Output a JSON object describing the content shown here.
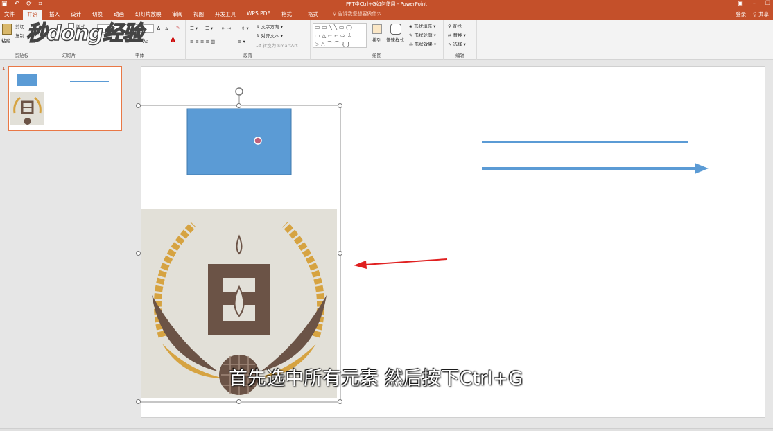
{
  "titlebar": {
    "title": "PPT中Ctrl+G如何使用 - PowerPoint",
    "quick_access": [
      "↶",
      "⟳",
      "⌗"
    ]
  },
  "tabs": [
    "文件",
    "开始",
    "插入",
    "设计",
    "切换",
    "动画",
    "幻灯片放映",
    "审阅",
    "视图",
    "开发工具",
    "WPS PDF",
    "格式",
    "格式"
  ],
  "active_tab": "开始",
  "tell_me": "♀ 告诉我您想要做什么...",
  "account": {
    "login": "登录",
    "share": "共享"
  },
  "ribbon": {
    "clipboard": {
      "paste": "粘贴",
      "cut": "剪切",
      "copy": "复制",
      "label": "剪贴板"
    },
    "slides": {
      "layout": "版式",
      "label": "幻灯片"
    },
    "font": {
      "grow": "A",
      "shrink": "A",
      "label": "字体",
      "spacing": "Aa"
    },
    "paragraph": {
      "text_direction": "文字方向",
      "align_text": "对齐文本",
      "smartart": "转换为 SmartArt",
      "label": "段落"
    },
    "drawing": {
      "arrange": "排列",
      "quick_styles": "快速样式",
      "fill": "形状填充",
      "outline": "形状轮廓",
      "effects": "形状效果",
      "label": "绘图"
    },
    "editing": {
      "find": "查找",
      "replace": "替换",
      "select": "选择",
      "label": "编辑"
    }
  },
  "watermark": "秒dong经验",
  "slide_number": "1",
  "caption": "首先选中所有元素 然后按下Ctrl+G",
  "colors": {
    "accent": "#c4502a",
    "shape_blue": "#5b9bd5",
    "arrow_red": "#e02020",
    "logo_bg": "#e2e0d8",
    "logo_brown": "#6b5346",
    "logo_gold": "#d6a341"
  }
}
